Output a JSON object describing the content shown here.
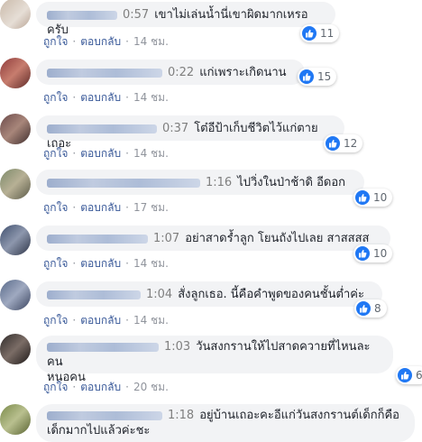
{
  "comments": [
    {
      "time": "0:57",
      "text": "เขาไม่เล่นน้ำนี่เขาผิดมากเหรอครับ",
      "likes": "11",
      "age": "14 ชม."
    },
    {
      "time": "0:22",
      "text": "แก่เพราะเกิดนาน",
      "likes": "15",
      "age": "14 ชม."
    },
    {
      "time": "0:37",
      "text": "โต๋อีป้าเก็บชีวิตไว้แก่ตายเถอะ",
      "likes": "12",
      "age": "14 ชม."
    },
    {
      "time": "1:16",
      "text": "ไปวิ่งในป่าช้าดิ อีดอก",
      "likes": "10",
      "age": "17 ชม."
    },
    {
      "time": "1:07",
      "text": "อย่าสาดร้ำลูก โยนถังไปเลย สาสสสส",
      "likes": "10",
      "age": "14 ชม."
    },
    {
      "time": "1:04",
      "text": "สั่งลูกเธอ. นี้คือคำพูดของคนชั้นต่ำค่ะ",
      "likes": "8",
      "age": "14 ชม."
    },
    {
      "time": "1:03",
      "text": "วันสงกรานให้ไปสาดควายที่ไหนละคน",
      "text2": "หนอคน",
      "likes": "6",
      "age": "20 ชม."
    },
    {
      "time": "1:18",
      "text": "อยู่บ้านเถอะคะอีแก่วันสงกรานต์เด็กก็คือ",
      "text2": "เด็กมากไปแล้วค่ะชะ"
    }
  ],
  "labels": {
    "like": "ถูกใจ",
    "reply": "ตอบกลับ",
    "dot": "·"
  },
  "colors": {
    "like_blue": "#2078f4",
    "link": "#385898",
    "bubble": "#f2f3f5"
  },
  "icons": {
    "reaction": "thumbs-up-icon"
  }
}
